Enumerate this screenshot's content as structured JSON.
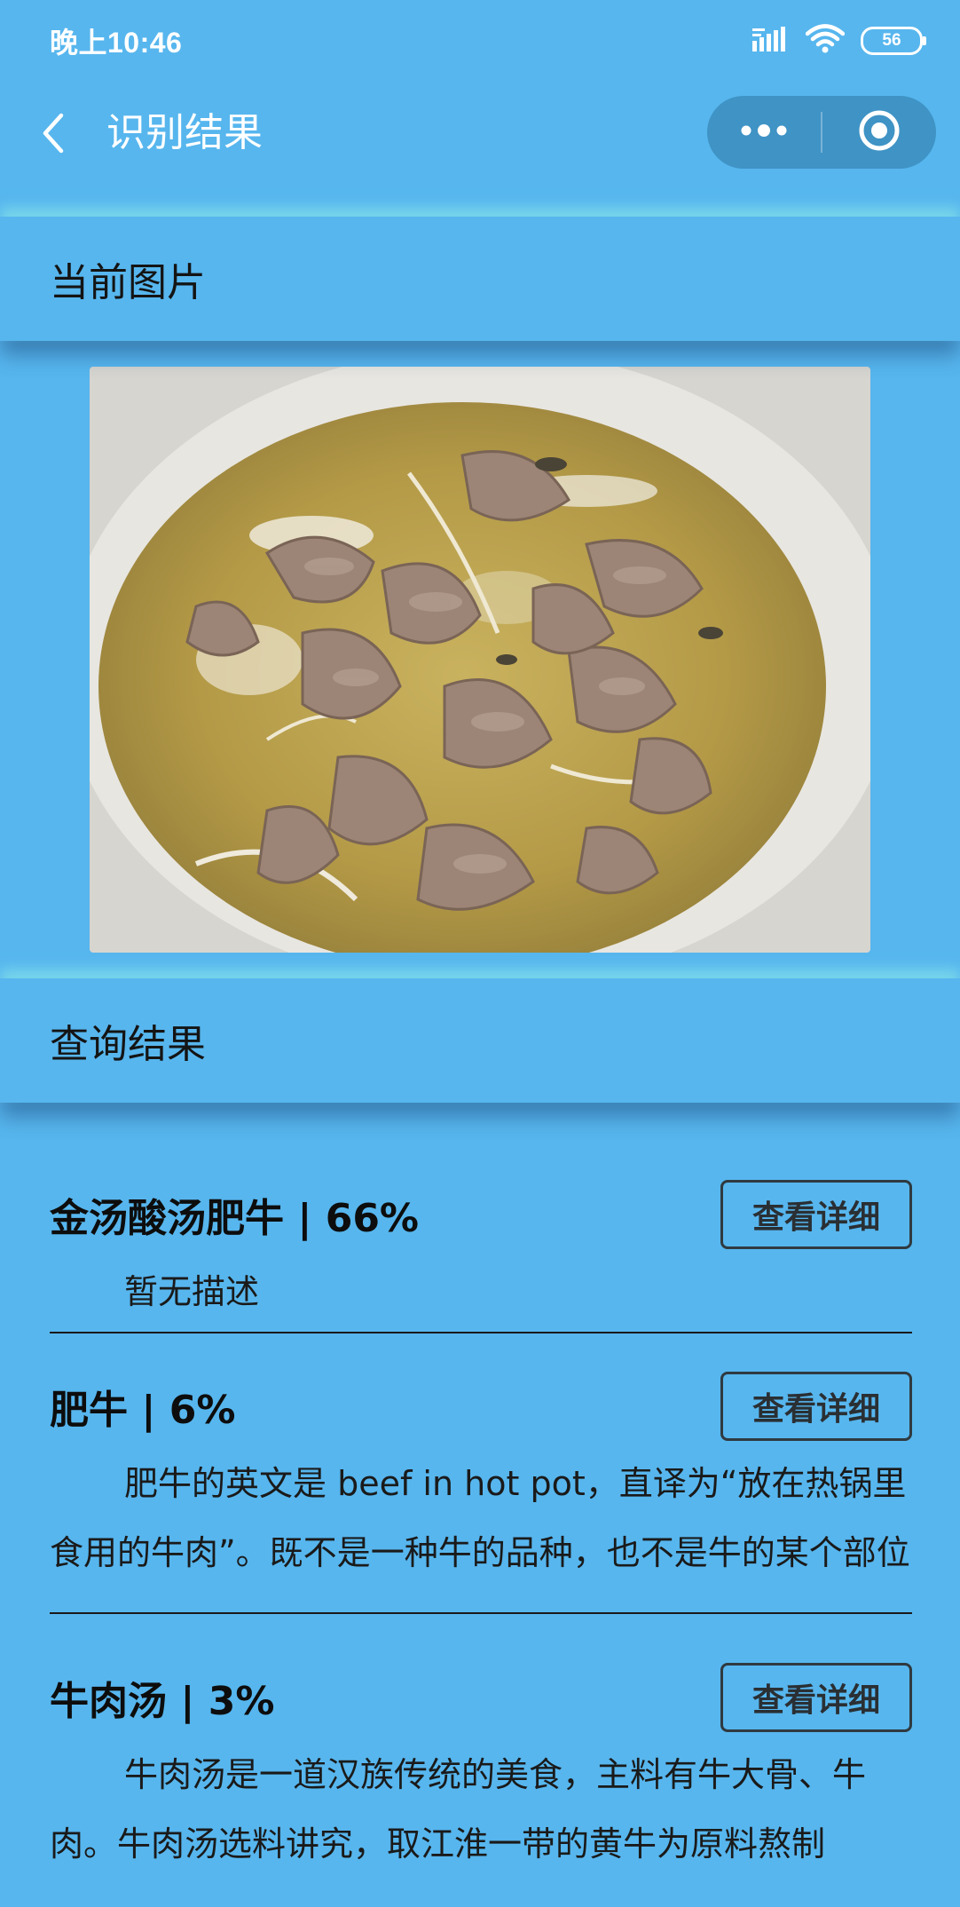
{
  "status_bar": {
    "time": "晚上10:46",
    "battery": "56",
    "icons": [
      "signal-icon",
      "wifi-icon",
      "battery-icon"
    ]
  },
  "nav": {
    "title": "识别结果",
    "icons": [
      "back-icon",
      "more-icon",
      "close-miniprogram-icon"
    ]
  },
  "sections": {
    "current_image": "当前图片",
    "query_result": "查询结果"
  },
  "results": [
    {
      "name": "金汤酸汤肥牛 | 66%",
      "button": "查看详细",
      "description": "暂无描述"
    },
    {
      "name": "肥牛 | 6%",
      "button": "查看详细",
      "description": "肥牛的英文是 beef in hot pot，直译为“放在热锅里食用的牛肉”。既不是一种牛的品种，也不是牛的某个部位"
    },
    {
      "name": "牛肉汤 | 3%",
      "button": "查看详细",
      "description": "牛肉汤是一道汉族传统的美食，主料有牛大骨、牛肉。牛肉汤选料讲究，取江淮一带的黄牛为原料熬制"
    }
  ],
  "colors": {
    "background": "#57b6ee",
    "capsule": "#3f93c5"
  }
}
